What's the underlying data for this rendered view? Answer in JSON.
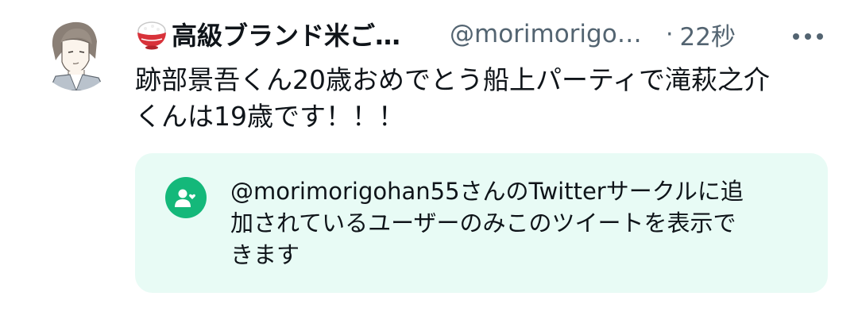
{
  "tweet": {
    "author": {
      "display_name": "高級ブランド米ご…",
      "name_emoji": "rice-bowl-icon",
      "handle": "@morimorigo…"
    },
    "separator": "·",
    "time": "22秒",
    "more_icon": "more-horizontal-icon",
    "text_line1": "跡部景吾くん20歳おめでとう船上パーティで滝萩之介",
    "text_line2": "くんは19歳です！！！",
    "circle_notice": {
      "icon": "circle-people-icon",
      "text_line1": "@morimorigohan55さんのTwitterサークルに追",
      "text_line2": "加されているユーザーのみこのツイートを表示で",
      "text_line3": "きます"
    }
  },
  "colors": {
    "primary_text": "#0f1419",
    "secondary_text": "#536471",
    "circle_bg": "#e8fbf5",
    "circle_accent": "#14b87a"
  }
}
